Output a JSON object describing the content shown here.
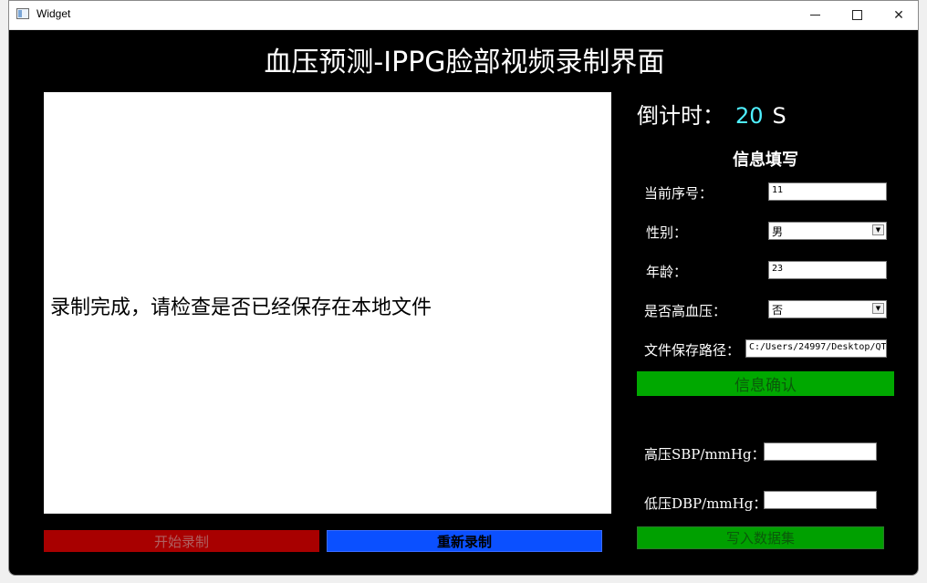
{
  "window": {
    "title": "Widget",
    "min_icon": "minimize-icon",
    "max_icon": "maximize-icon",
    "close_icon": "close-icon",
    "close_glyph": "✕"
  },
  "heading": "血压预测-IPPG脸部视频录制界面",
  "video": {
    "status": "录制完成，请检查是否已经保存在本地文件"
  },
  "buttons": {
    "start": "开始录制",
    "restart": "重新录制",
    "confirm": "信息确认",
    "write": "写入数据集"
  },
  "countdown": {
    "label": "倒计时：",
    "value": "20",
    "unit": "S"
  },
  "info": {
    "title": "信息填写",
    "serial_label": "当前序号：",
    "serial_value": "11",
    "gender_label": "性别：",
    "gender_value": "男",
    "age_label": "年龄：",
    "age_value": "23",
    "hypertension_label": "是否高血压：",
    "hypertension_value": "否",
    "path_label": "文件保存路径：",
    "path_value": "C:/Users/24997/Desktop/QT"
  },
  "bp": {
    "sbp_label": "高压SBP/mmHg：",
    "sbp_value": "",
    "dbp_label": "低压DBP/mmHg：",
    "dbp_value": ""
  },
  "colors": {
    "background": "#000000",
    "start_button": "#a80000",
    "restart_button": "#0b50ff",
    "confirm_button": "#00a800",
    "countdown_value": "#4ff0ff"
  }
}
